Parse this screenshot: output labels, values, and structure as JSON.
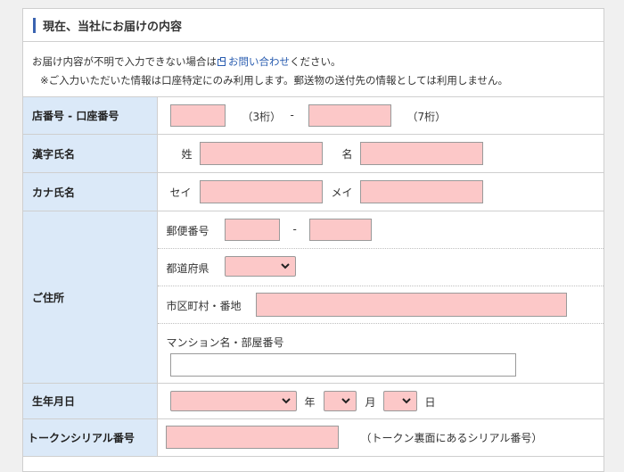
{
  "section": {
    "title": "現在、当社にお届けの内容"
  },
  "notice": {
    "line1_prefix": "お届け内容が不明で入力できない場合は",
    "link_text": "お問い合わせ",
    "line1_suffix": "ください。",
    "line2": "※ご入力いただいた情報は口座特定にのみ利用します。郵送物の送付先の情報としては利用しません。"
  },
  "rows": {
    "account": {
      "label": "店番号 - 口座番号",
      "branch_hint": "（3桁）",
      "separator": "-",
      "account_hint": "（7桁）"
    },
    "kanji_name": {
      "label": "漢字氏名",
      "sei": "姓",
      "mei": "名"
    },
    "kana_name": {
      "label": "カナ氏名",
      "sei": "セイ",
      "mei": "メイ"
    },
    "address": {
      "label": "ご住所",
      "postal_label": "郵便番号",
      "postal_separator": "-",
      "prefecture_label": "都道府県",
      "city_label": "市区町村・番地",
      "building_label": "マンション名・部屋番号"
    },
    "birthdate": {
      "label": "生年月日",
      "year": "年",
      "month": "月",
      "day": "日"
    },
    "token": {
      "label": "トークンシリアル番号",
      "hint": "（トークン裏面にあるシリアル番号）"
    }
  },
  "colors": {
    "required_field_bg": "#fcc8c8",
    "label_bg": "#dbe9f8",
    "accent": "#3a63b0",
    "link": "#2a5db0"
  }
}
